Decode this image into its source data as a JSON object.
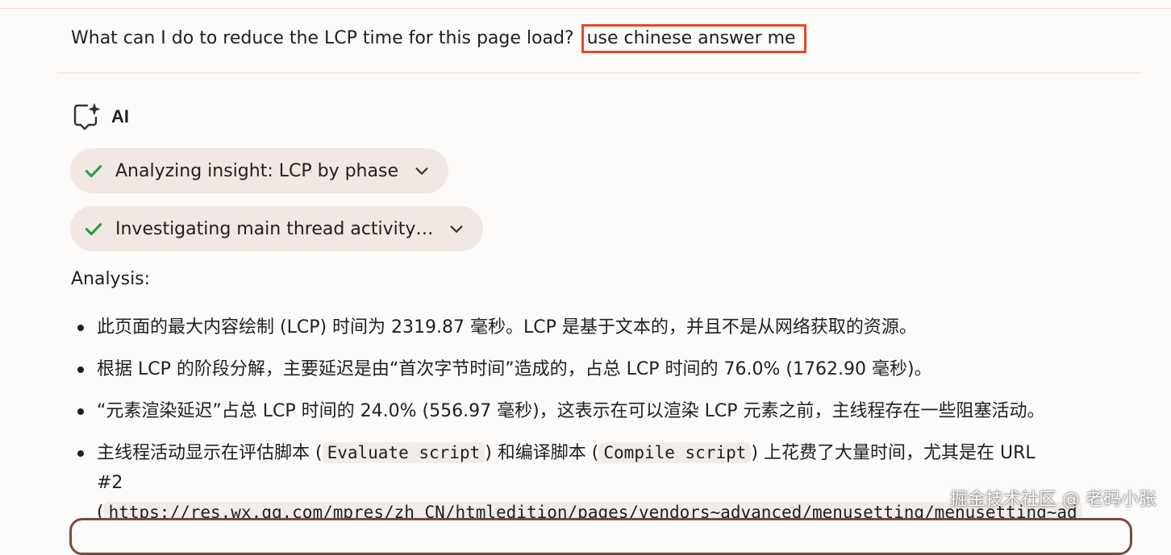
{
  "question": {
    "text": "What can I do to reduce the LCP time for this page load?",
    "highlighted": "use chinese answer me"
  },
  "ai": {
    "label": "AI",
    "icon": "ai-sparkle-chat-icon"
  },
  "steps": [
    {
      "label": "Analyzing insight: LCP by phase",
      "status": "done"
    },
    {
      "label": "Investigating main thread activity…",
      "status": "done"
    }
  ],
  "analysis_heading": "Analysis:",
  "findings": [
    "此页面的最大内容绘制 (LCP) 时间为 2319.87 毫秒。LCP 是基于文本的，并且不是从网络获取的资源。",
    "根据 LCP 的阶段分解，主要延迟是由“首次字节时间”造成的，占总 LCP 时间的 76.0% (1762.90 毫秒)。",
    "“元素渲染延迟”占总 LCP 时间的 24.0% (556.97 毫秒)，这表示在可以渲染 LCP 元素之前，主线程存在一些阻塞活动。"
  ],
  "finding4": {
    "pre": "主线程活动显示在评估脚本 (",
    "code1": "Evaluate script",
    "mid": ") 和编译脚本 (",
    "code2": "Compile script",
    "post": ") 上花费了大量时间，尤其是在 URL",
    "line2": "#2",
    "url_prefix": "(",
    "url": "https://res.wx.qq.com/mpres/zh_CN/htmledition/pages/vendors~advanced/menusetting/menusetting~ad"
  },
  "watermark": "掘金技术社区 @ 老码小张",
  "colors": {
    "highlight_border": "#e24a2a",
    "check": "#1f9d4c",
    "chip_bg": "#f1e7e3"
  }
}
